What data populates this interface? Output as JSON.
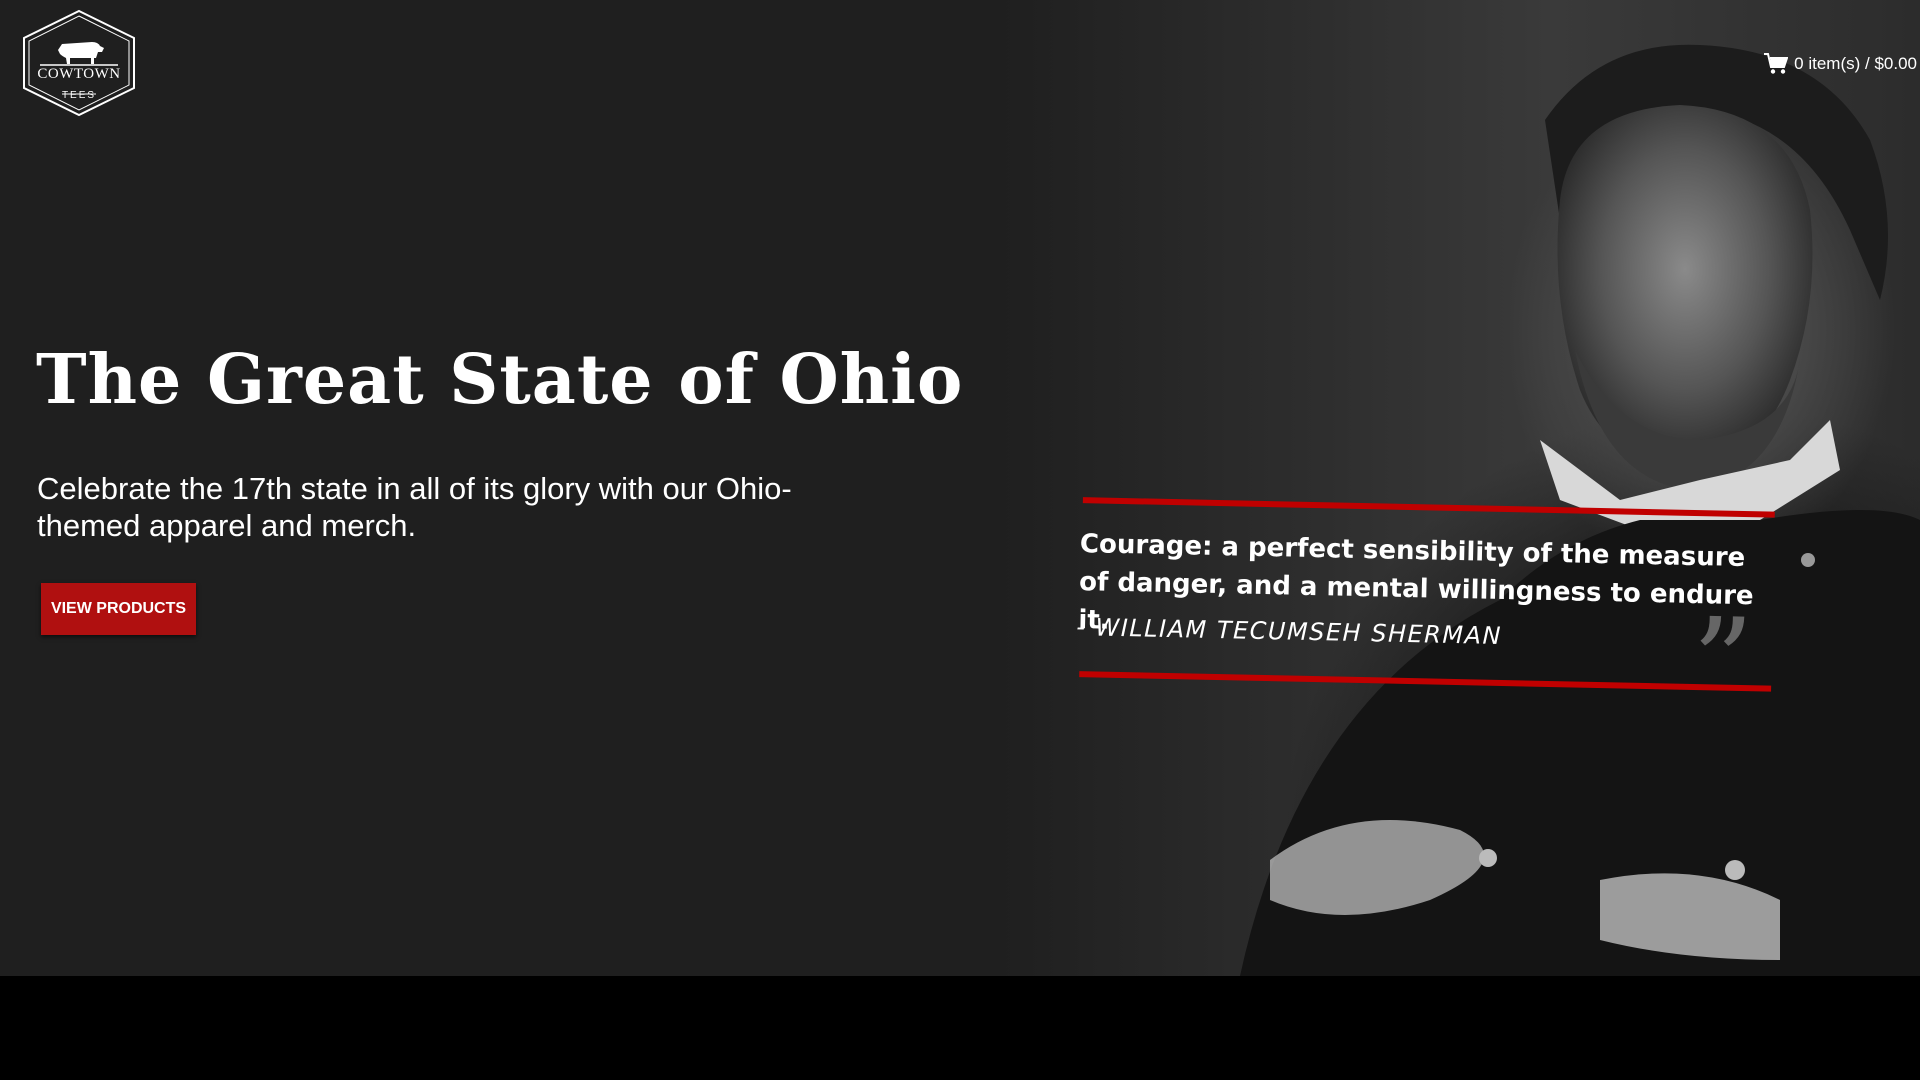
{
  "brand": {
    "name": "COWTOWN",
    "sub": "TEES"
  },
  "cart": {
    "label": "0 item(s) / $0.00",
    "icon": "shopping-cart-icon"
  },
  "hero": {
    "title": "The Great State of Ohio",
    "description": "Celebrate the 17th state in all of its glory with our Ohio-themed apparel and merch.",
    "cta_label": "VIEW PRODUCTS"
  },
  "quote": {
    "text": "Courage: a perfect sensibility of the measure of danger, and a mental willingness to endure it.",
    "author": "- WILLIAM TECUMSEH SHERMAN",
    "mark": "”"
  },
  "colors": {
    "background": "#1f1f1f",
    "footer": "#000000",
    "accent": "#c00000",
    "button": "#b01010",
    "text": "#ffffff"
  }
}
